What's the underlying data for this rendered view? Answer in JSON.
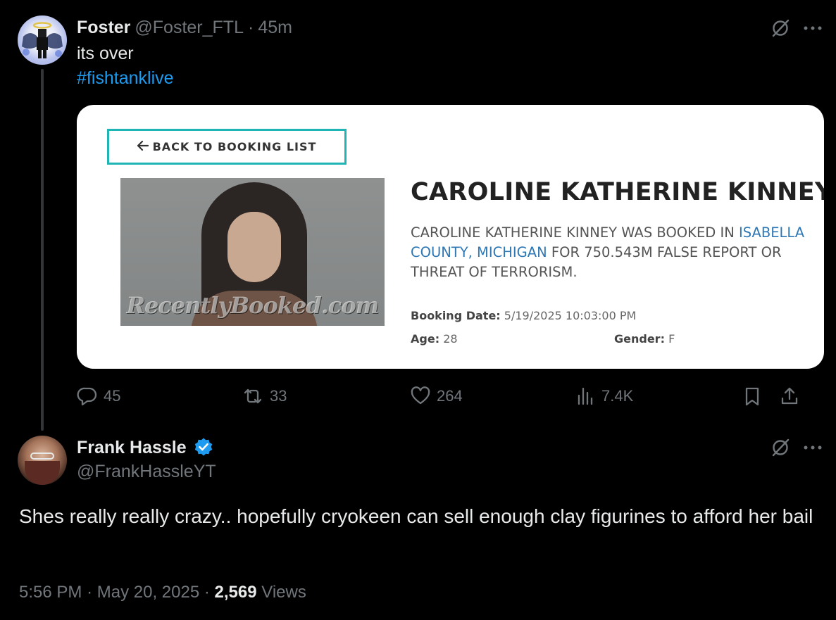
{
  "parent_tweet": {
    "display_name": "Foster",
    "handle": "@Foster_FTL",
    "separator": "·",
    "time": "45m",
    "text": "its over",
    "hashtag": "#fishtanklive",
    "image": {
      "back_label": "BACK TO BOOKING LIST",
      "watermark": "RecentlyBooked.com",
      "name": "CAROLINE KATHERINE KINNEY",
      "summary_pre": "CAROLINE KATHERINE KINNEY WAS BOOKED IN",
      "summary_county": "ISABELLA COUNTY, MICHIGAN",
      "summary_post": "FOR 750.543M FALSE REPORT OR THREAT OF TERRORISM.",
      "booking_date_label": "Booking Date:",
      "booking_date_value": "5/19/2025 10:03:00 PM",
      "age_label": "Age:",
      "age_value": "28",
      "gender_label": "Gender:",
      "gender_value": "F"
    },
    "actions": {
      "replies": "45",
      "reposts": "33",
      "likes": "264",
      "views": "7.4K"
    }
  },
  "reply_tweet": {
    "display_name": "Frank Hassle",
    "handle": "@FrankHassleYT",
    "text": "Shes really really crazy.. hopefully cryokeen can sell enough clay figurines to afford her bail",
    "time": "5:56 PM",
    "separator": "·",
    "date": "May 20, 2025",
    "views_count": "2,569",
    "views_label": "Views"
  },
  "colors": {
    "background": "#000000",
    "text": "#e7e9ea",
    "muted": "#71767b",
    "accent": "#1d9bf0",
    "card_border": "#1fb5b5"
  }
}
